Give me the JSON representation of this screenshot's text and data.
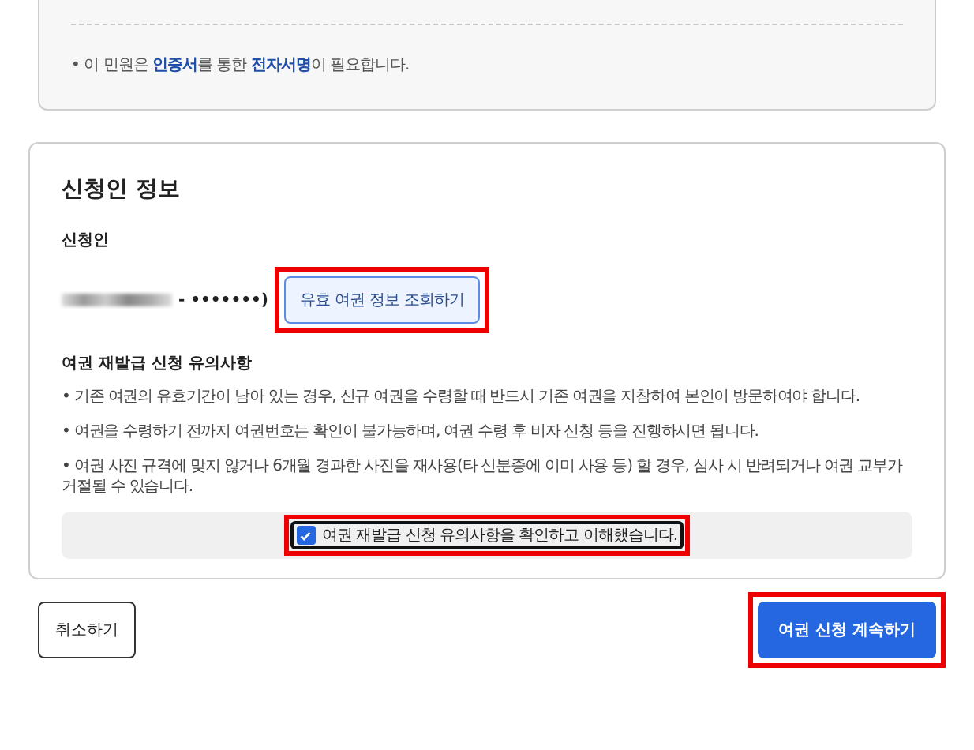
{
  "notice_card": {
    "note": "• 이 민원은 **인증서**를 통한 **전자서명**이 필요합니다."
  },
  "applicant_card": {
    "title": "신청인 정보",
    "applicant_label": "신청인",
    "applicant_redacted": true,
    "applicant_value": "- •••••••)",
    "lookup_button": {
      "label": "유효 여권 정보 조회하기",
      "highlighted": true
    },
    "caution_title": "여권 재발급 신청 유의사항",
    "cautions": [
      "• 기존 여권의 유효기간이 남아 있는 경우, 신규 여권을 수령할 때 반드시 기존 여권을 지참하여 본인이 방문하여야 합니다.",
      "• 여권을 수령하기 전까지 여권번호는 확인이 불가능하며, 여권 수령 후 비자 신청 등을 진행하시면 됩니다.",
      "• 여권 사진 규격에 맞지 않거나 6개월 경과한 사진을 재사용(타 신분증에 이미 사용 등) 할 경우, 심사 시 반려되거나 여권 교부가 거절될 수 있습니다."
    ],
    "agreement": {
      "label": "여권 재발급 신청 유의사항을 확인하고 이해했습니다.",
      "checked": true,
      "highlighted": true
    }
  },
  "buttons": [
    {
      "kind": "secondary",
      "label": "취소하기",
      "highlighted": false
    },
    {
      "kind": "primary",
      "label": "여권 신청 계속하기",
      "highlighted": true
    }
  ]
}
